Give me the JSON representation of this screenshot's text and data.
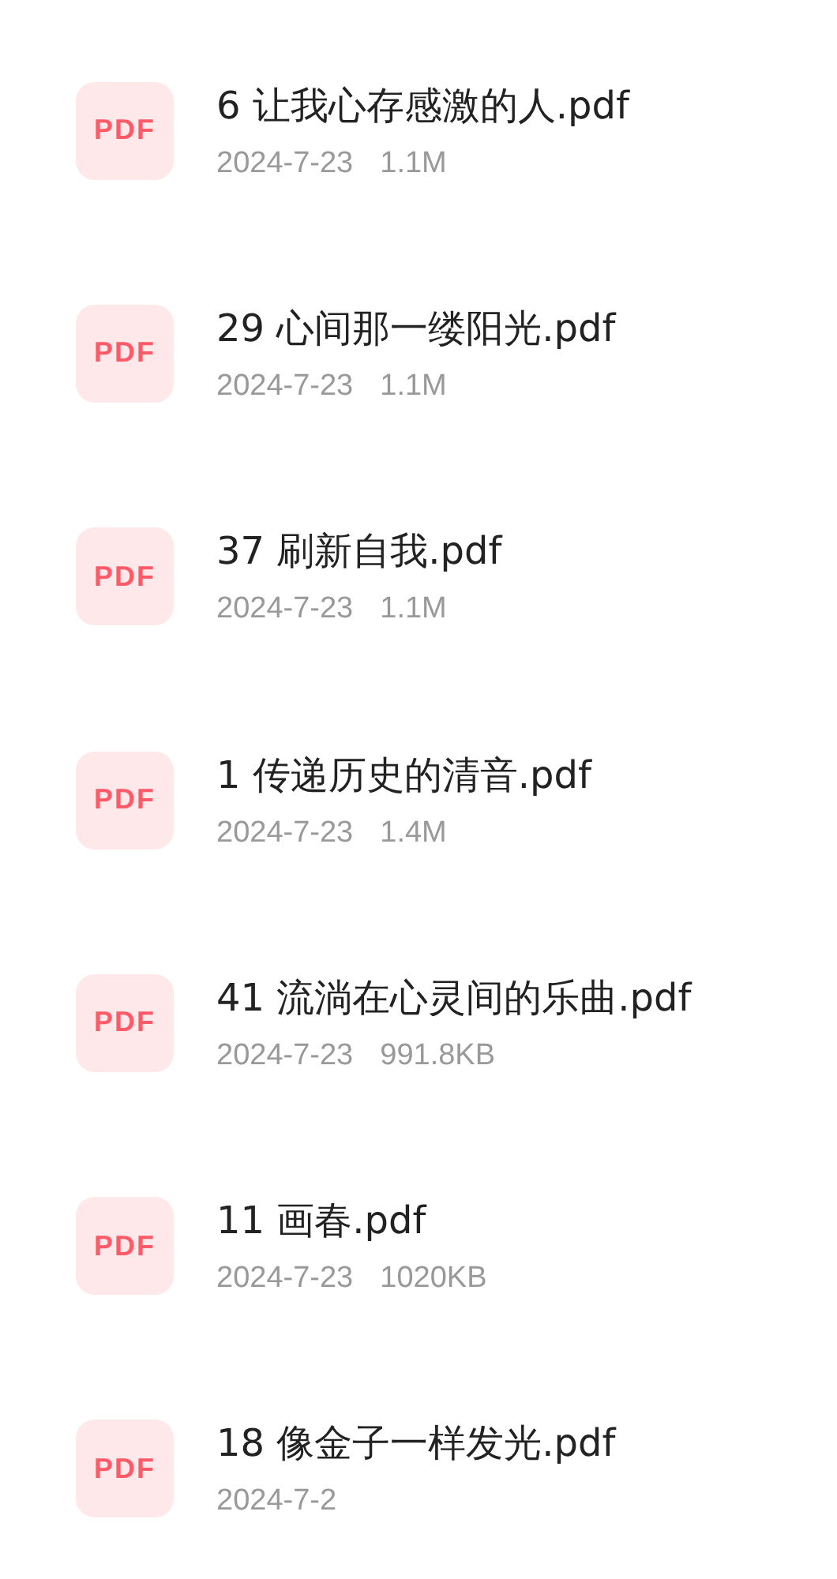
{
  "files": [
    {
      "icon_label": "PDF",
      "name": "6 让我心存感激的人.pdf",
      "date": "2024-7-23",
      "size": "1.1M"
    },
    {
      "icon_label": "PDF",
      "name": "29 心间那一缕阳光.pdf",
      "date": "2024-7-23",
      "size": "1.1M"
    },
    {
      "icon_label": "PDF",
      "name": "37 刷新自我.pdf",
      "date": "2024-7-23",
      "size": "1.1M"
    },
    {
      "icon_label": "PDF",
      "name": "1 传递历史的清音.pdf",
      "date": "2024-7-23",
      "size": "1.4M"
    },
    {
      "icon_label": "PDF",
      "name": "41 流淌在心灵间的乐曲.pdf",
      "date": "2024-7-23",
      "size": "991.8KB"
    },
    {
      "icon_label": "PDF",
      "name": "11 画春.pdf",
      "date": "2024-7-23",
      "size": "1020KB"
    },
    {
      "icon_label": "PDF",
      "name": "18 像金子一样发光.pdf",
      "date": "2024-7-2"
    }
  ]
}
